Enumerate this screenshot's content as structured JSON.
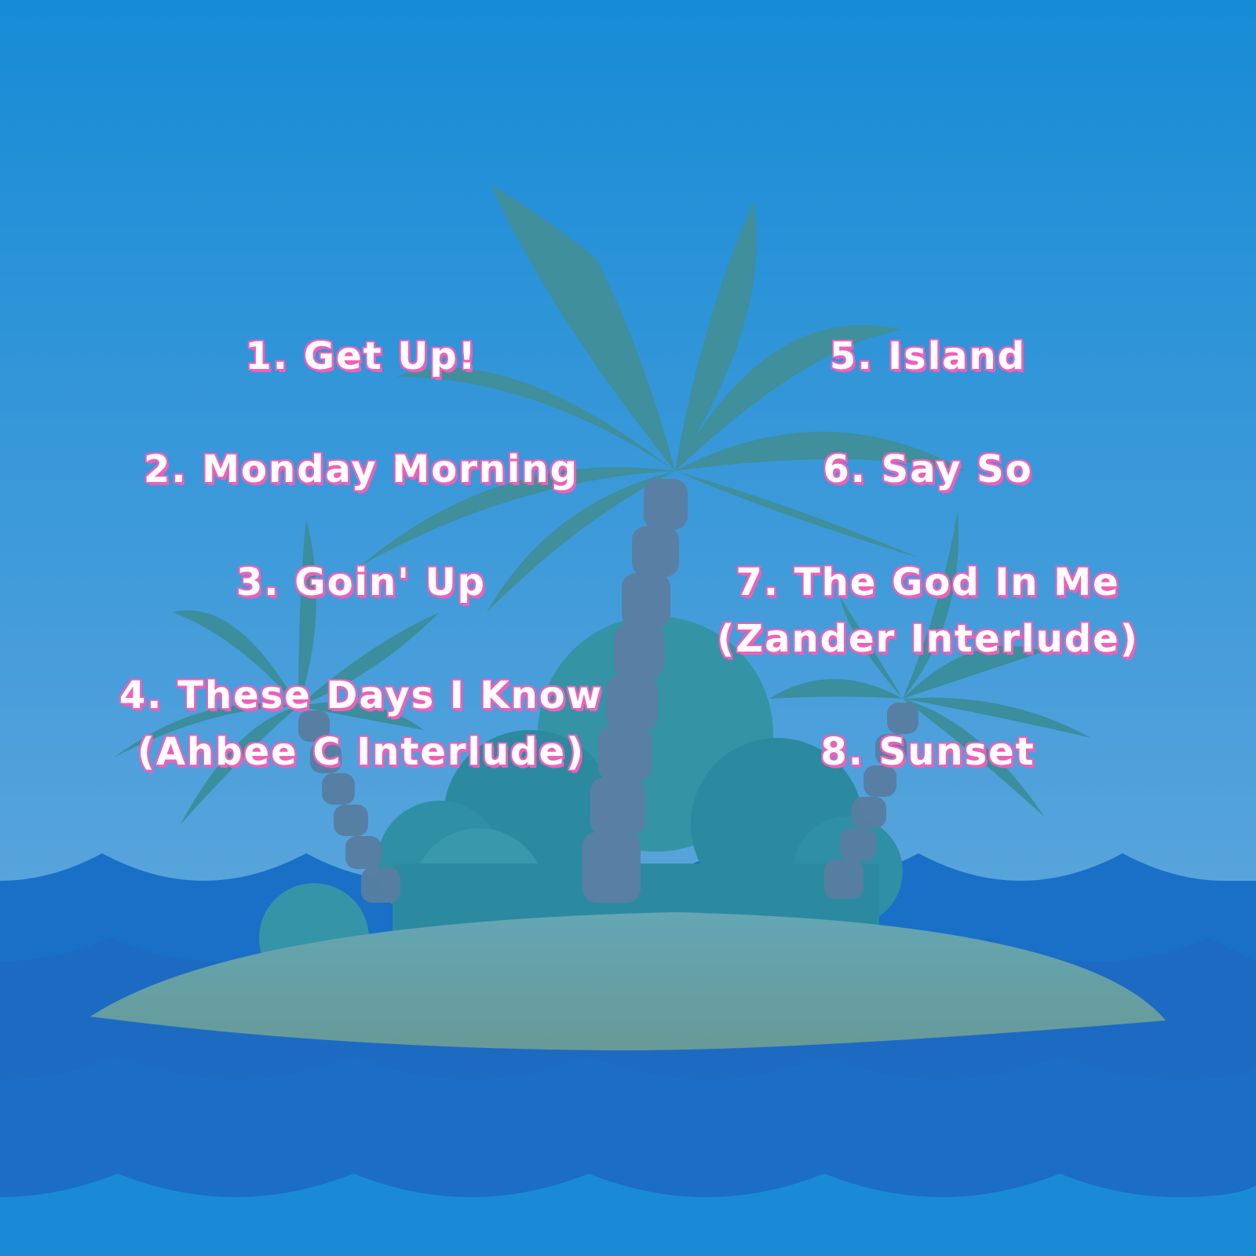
{
  "colors": {
    "sky_top": "#168bd6",
    "sky_bottom": "#58a4dc",
    "sea_back": "#1a6fc7",
    "sea_mid": "#1c6cc4",
    "sea_front": "#1a8ad6",
    "island": "#679d9e",
    "foliage": "#3a8e9a",
    "trunk": "#587ea2",
    "text": "#ffffff",
    "text_outline": "#f05fb8"
  },
  "tracklist": {
    "left": [
      {
        "lines": [
          "1. Get Up!"
        ]
      },
      {
        "lines": [
          "2. Monday Morning"
        ]
      },
      {
        "lines": [
          "3. Goin' Up"
        ]
      },
      {
        "lines": [
          "4. These Days I Know",
          "(Ahbee C Interlude)"
        ]
      }
    ],
    "right": [
      {
        "lines": [
          "5. Island"
        ]
      },
      {
        "lines": [
          "6. Say So"
        ]
      },
      {
        "lines": [
          "7. The God In Me",
          "(Zander Interlude)"
        ]
      },
      {
        "lines": [
          "8. Sunset"
        ]
      }
    ]
  }
}
